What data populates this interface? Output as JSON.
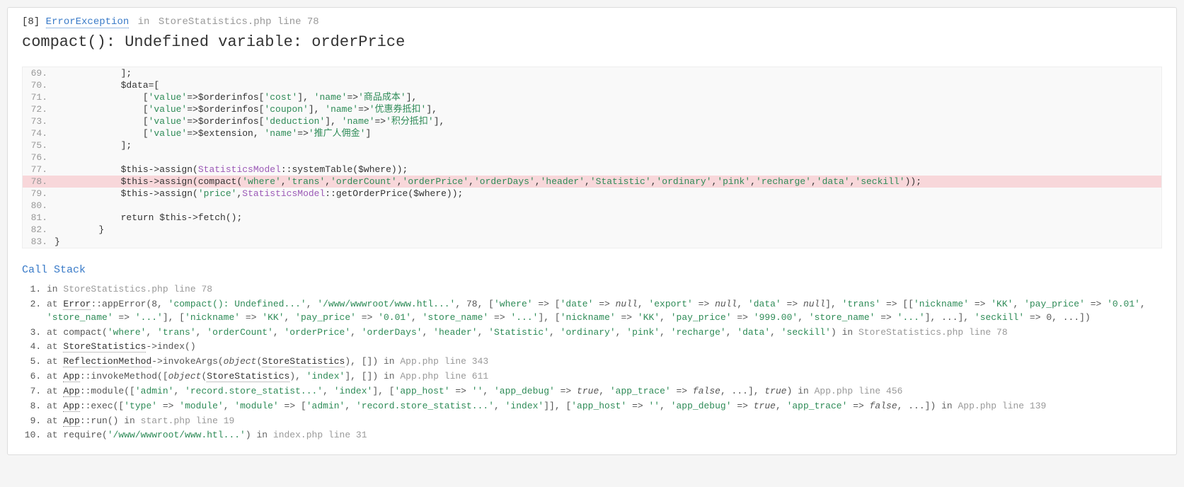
{
  "header": {
    "errno": "[8]",
    "exception": "ErrorException",
    "in_word": "in",
    "location": "StoreStatistics.php line 78"
  },
  "message": "compact(): Undefined variable: orderPrice",
  "code": {
    "start": 69,
    "highlight": 78,
    "lines": [
      {
        "n": 69,
        "html": "            ];"
      },
      {
        "n": 70,
        "html": "            $data=["
      },
      {
        "n": 71,
        "html": "                [<span class=\"c-str\">'value'</span>=>$orderinfos[<span class=\"c-str\">'cost'</span>], <span class=\"c-str\">'name'</span>=><span class=\"c-str\">'商品成本'</span>],"
      },
      {
        "n": 72,
        "html": "                [<span class=\"c-str\">'value'</span>=>$orderinfos[<span class=\"c-str\">'coupon'</span>], <span class=\"c-str\">'name'</span>=><span class=\"c-str\">'优惠券抵扣'</span>],"
      },
      {
        "n": 73,
        "html": "                [<span class=\"c-str\">'value'</span>=>$orderinfos[<span class=\"c-str\">'deduction'</span>], <span class=\"c-str\">'name'</span>=><span class=\"c-str\">'积分抵扣'</span>],"
      },
      {
        "n": 74,
        "html": "                [<span class=\"c-str\">'value'</span>=>$extension, <span class=\"c-str\">'name'</span>=><span class=\"c-str\">'推广人佣金'</span>]"
      },
      {
        "n": 75,
        "html": "            ];"
      },
      {
        "n": 76,
        "html": ""
      },
      {
        "n": 77,
        "html": "            $this->assign(<span class=\"c-cls\">StatisticsModel</span>::systemTable($where));"
      },
      {
        "n": 78,
        "html": "            $this->assign(compact(<span class=\"c-str\">'where'</span>,<span class=\"c-str\">'trans'</span>,<span class=\"c-str\">'orderCount'</span>,<span class=\"c-str\">'orderPrice'</span>,<span class=\"c-str\">'orderDays'</span>,<span class=\"c-str\">'header'</span>,<span class=\"c-str\">'Statistic'</span>,<span class=\"c-str\">'ordinary'</span>,<span class=\"c-str\">'pink'</span>,<span class=\"c-str\">'recharge'</span>,<span class=\"c-str\">'data'</span>,<span class=\"c-str\">'seckill'</span>));"
      },
      {
        "n": 79,
        "html": "            $this->assign(<span class=\"c-str\">'price'</span>,<span class=\"c-cls\">StatisticsModel</span>::getOrderPrice($where));"
      },
      {
        "n": 80,
        "html": ""
      },
      {
        "n": 81,
        "html": "            return $this->fetch();"
      },
      {
        "n": 82,
        "html": "        }"
      },
      {
        "n": 83,
        "html": "}"
      }
    ]
  },
  "call_stack_title": "Call Stack",
  "stack": [
    {
      "html": "<span class=\"kw-in\">in</span> <span class=\"loc\">StoreStatistics.php line 78</span>"
    },
    {
      "html": "<span class=\"kw-at\">at</span> <span class=\"fn\">Error</span>::appError(8, <span class=\"str\">'compact(): Undefined...'</span>, <span class=\"str\">'/www/wwwroot/www.htl...'</span>, 78, [<span class=\"str\">'where'</span> => [<span class=\"str\">'date'</span> => <span class=\"null\">null</span>, <span class=\"str\">'export'</span> => <span class=\"null\">null</span>, <span class=\"str\">'data'</span> => <span class=\"null\">null</span>], <span class=\"str\">'trans'</span> => [[<span class=\"str\">'nickname'</span> => <span class=\"str\">'KK'</span>, <span class=\"str\">'pay_price'</span> => <span class=\"str\">'0.01'</span>, <span class=\"str\">'store_name'</span> => <span class=\"str\">'...'</span>], [<span class=\"str\">'nickname'</span> => <span class=\"str\">'KK'</span>, <span class=\"str\">'pay_price'</span> => <span class=\"str\">'0.01'</span>, <span class=\"str\">'store_name'</span> => <span class=\"str\">'...'</span>], [<span class=\"str\">'nickname'</span> => <span class=\"str\">'KK'</span>, <span class=\"str\">'pay_price'</span> => <span class=\"str\">'999.00'</span>, <span class=\"str\">'store_name'</span> => <span class=\"str\">'...'</span>], ...], <span class=\"str\">'seckill'</span> => 0, ...])"
    },
    {
      "html": "<span class=\"kw-at\">at</span> compact(<span class=\"str\">'where'</span>, <span class=\"str\">'trans'</span>, <span class=\"str\">'orderCount'</span>, <span class=\"str\">'orderPrice'</span>, <span class=\"str\">'orderDays'</span>, <span class=\"str\">'header'</span>, <span class=\"str\">'Statistic'</span>, <span class=\"str\">'ordinary'</span>, <span class=\"str\">'pink'</span>, <span class=\"str\">'recharge'</span>, <span class=\"str\">'data'</span>, <span class=\"str\">'seckill'</span>) <span class=\"kw-in\">in</span> <span class=\"loc\">StoreStatistics.php line 78</span>"
    },
    {
      "html": "<span class=\"kw-at\">at</span> <span class=\"fn\">StoreStatistics</span>->index()"
    },
    {
      "html": "<span class=\"kw-at\">at</span> <span class=\"fn\">ReflectionMethod</span>->invokeArgs(<span class=\"ital\">object</span>(<span class=\"fn\">StoreStatistics</span>), []) <span class=\"kw-in\">in</span> <span class=\"loc\">App.php line 343</span>"
    },
    {
      "html": "<span class=\"kw-at\">at</span> <span class=\"fn\">App</span>::invokeMethod([<span class=\"ital\">object</span>(<span class=\"fn\">StoreStatistics</span>), <span class=\"str\">'index'</span>], []) <span class=\"kw-in\">in</span> <span class=\"loc\">App.php line 611</span>"
    },
    {
      "html": "<span class=\"kw-at\">at</span> <span class=\"fn\">App</span>::module([<span class=\"str\">'admin'</span>, <span class=\"str\">'record.store_statist...'</span>, <span class=\"str\">'index'</span>], [<span class=\"str\">'app_host'</span> => <span class=\"str\">''</span>, <span class=\"str\">'app_debug'</span> => <span class=\"ital\">true</span>, <span class=\"str\">'app_trace'</span> => <span class=\"ital\">false</span>, ...], <span class=\"ital\">true</span>) <span class=\"kw-in\">in</span> <span class=\"loc\">App.php line 456</span>"
    },
    {
      "html": "<span class=\"kw-at\">at</span> <span class=\"fn\">App</span>::exec([<span class=\"str\">'type'</span> => <span class=\"str\">'module'</span>, <span class=\"str\">'module'</span> => [<span class=\"str\">'admin'</span>, <span class=\"str\">'record.store_statist...'</span>, <span class=\"str\">'index'</span>]], [<span class=\"str\">'app_host'</span> => <span class=\"str\">''</span>, <span class=\"str\">'app_debug'</span> => <span class=\"ital\">true</span>, <span class=\"str\">'app_trace'</span> => <span class=\"ital\">false</span>, ...]) <span class=\"kw-in\">in</span> <span class=\"loc\">App.php line 139</span>"
    },
    {
      "html": "<span class=\"kw-at\">at</span> <span class=\"fn\">App</span>::run() <span class=\"kw-in\">in</span> <span class=\"loc\">start.php line 19</span>"
    },
    {
      "html": "<span class=\"kw-at\">at</span> require(<span class=\"str\">'/www/wwwroot/www.htl...'</span>) <span class=\"kw-in\">in</span> <span class=\"loc\">index.php line 31</span>"
    }
  ]
}
